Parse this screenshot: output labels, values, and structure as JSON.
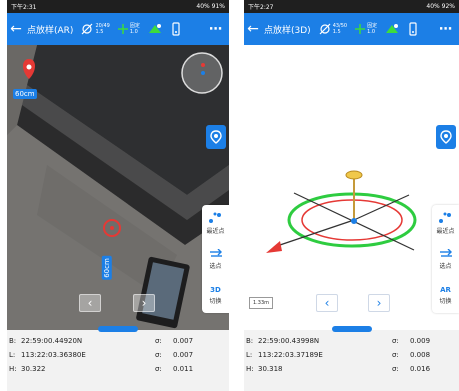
{
  "left": {
    "status_time": "下午2:31",
    "status_right": "40% 91%",
    "title": "点放样(AR)",
    "sats": "20/49",
    "sats_sub": "1.5",
    "fix": "固定",
    "fix_sub": "1.0",
    "top_label": "60cm",
    "side_label": "60cm",
    "panel": [
      "最近点",
      "选点",
      "切换"
    ],
    "switch_icon": "3D",
    "B_label": "B:",
    "B": "22:59:00.44920N",
    "L_label": "L:",
    "L": "113:22:03.36380E",
    "H_label": "H:",
    "H": "30.322",
    "sigma_label": "σ:",
    "sB": "0.007",
    "sL": "0.007",
    "sH": "0.011"
  },
  "right": {
    "status_time": "下午2:27",
    "status_right": "40% 92%",
    "title": "点放样(3D)",
    "sats": "43/50",
    "sats_sub": "1.5",
    "fix": "固定",
    "fix_sub": "1.0",
    "scale": "1.33m",
    "panel": [
      "最近点",
      "选点",
      "切换"
    ],
    "switch_icon": "AR",
    "B_label": "B:",
    "B": "22:59:00.43998N",
    "L_label": "L:",
    "L": "113:22:03.37189E",
    "H_label": "H:",
    "H": "30.318",
    "sigma_label": "σ:",
    "sB": "0.009",
    "sL": "0.008",
    "sH": "0.016"
  },
  "colors": {
    "accent": "#1c7fe6",
    "target_red": "#e53935",
    "ring_green": "#2ecc40"
  }
}
